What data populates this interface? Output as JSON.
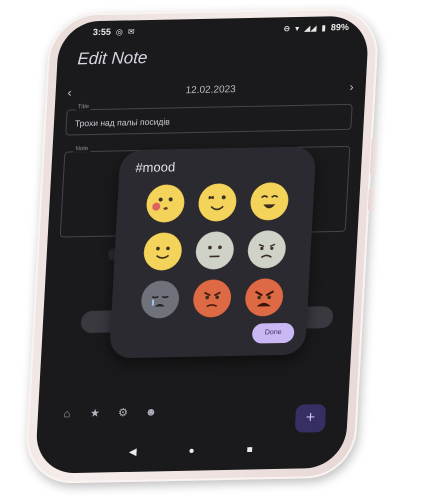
{
  "status_bar": {
    "time": "3:55",
    "battery": "89%"
  },
  "app": {
    "title": "Edit Note",
    "date": "12.02.2023"
  },
  "title_field": {
    "label": "Title",
    "value": "Трохи над пальі посидів"
  },
  "notes_field": {
    "label": "Note"
  },
  "mood_dialog": {
    "title": "#mood",
    "done_label": "Done",
    "moods": [
      {
        "name": "kiss",
        "color": "#f3d35a"
      },
      {
        "name": "wink-tongue",
        "color": "#f3d35a"
      },
      {
        "name": "excited",
        "color": "#f3d35a"
      },
      {
        "name": "smile",
        "color": "#f3d35a"
      },
      {
        "name": "neutral",
        "color": "#cfd2c6"
      },
      {
        "name": "sad",
        "color": "#cfd2c6"
      },
      {
        "name": "crying",
        "color": "#6f727a"
      },
      {
        "name": "angry",
        "color": "#dd6a44"
      },
      {
        "name": "furious",
        "color": "#dd6a44"
      }
    ]
  },
  "nav": {
    "items": [
      "home-icon",
      "star-icon",
      "gear-icon",
      "profile-icon"
    ],
    "fab_icon": "plus-icon"
  },
  "colors": {
    "screen_bg": "#1a1a1c",
    "dialog_bg": "#2c2a31",
    "accent": "#c9b8f3",
    "fab": "#352f64"
  }
}
